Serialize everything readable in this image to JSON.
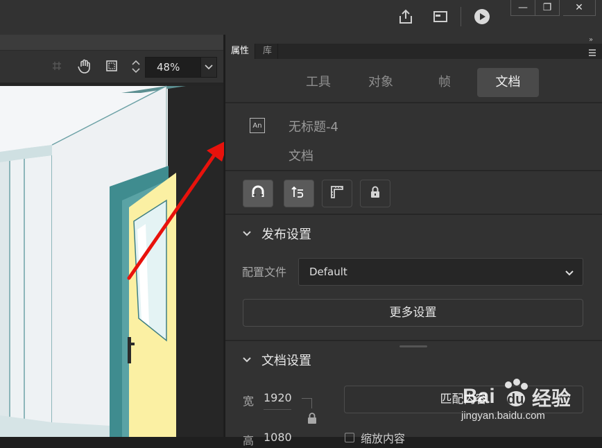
{
  "window": {
    "minimize_glyph": "—",
    "restore_glyph": "❐",
    "close_glyph": "✕"
  },
  "titlebar_icons": [
    "share-icon",
    "layout-icon",
    "play-icon"
  ],
  "stage": {
    "zoom_value": "48%"
  },
  "panel": {
    "tabs": [
      {
        "label": "属性"
      },
      {
        "label": "库"
      }
    ],
    "segments": [
      {
        "label": "工具"
      },
      {
        "label": "对象"
      },
      {
        "label": "帧"
      },
      {
        "label": "文档"
      }
    ],
    "doc_icon_text": "An",
    "doc_name": "无标题-4",
    "doc_type": "文档",
    "publish": {
      "title": "发布设置",
      "profile_label": "配置文件",
      "profile_value": "Default",
      "more_button": "更多设置"
    },
    "docsettings": {
      "title": "文档设置",
      "width_label": "宽",
      "width_value": "1920",
      "height_label": "高",
      "height_value": "1080",
      "match_button": "匹配内容",
      "scale_label": "缩放内容"
    }
  },
  "watermark": {
    "brand": "Bai",
    "brand2": "du",
    "brand_cn": "经验",
    "url": "jingyan.baidu.com"
  },
  "colors": {
    "accent_red": "#e8120c",
    "door_teal": "#3f8c8f",
    "door_yellow": "#fbf0a3"
  }
}
